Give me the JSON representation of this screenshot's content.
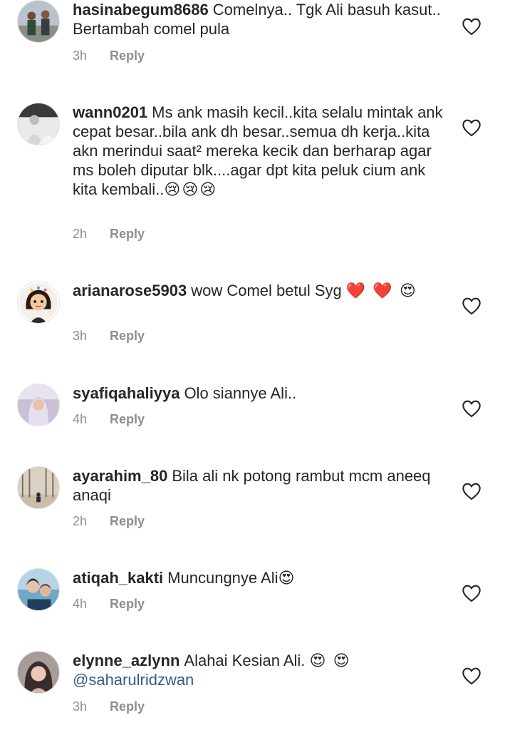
{
  "comments": [
    {
      "username": "hasinabegum8686",
      "text": "Comelnya.. Tgk Ali basuh kasut.. Bertambah comel pula",
      "emoji": "",
      "mention": "",
      "time": "3h",
      "reply": "Reply",
      "avatar": "group-photo-avatar"
    },
    {
      "username": "wann0201",
      "text": "Ms ank masih kecil..kita selalu mintak ank cepat besar..bila ank dh besar..semua dh kerja..kita akn merindui saat² mereka kecik dan berharap agar ms boleh diputar blk....agar dpt kita peluk cium ank kita kembali..",
      "emoji": "😢😢😢",
      "mention": "",
      "time": "2h",
      "reply": "Reply",
      "avatar": "grayscale-photo-avatar"
    },
    {
      "username": "arianarose5903",
      "text": "wow Comel betul Syg",
      "emoji": "❤️ ❤️ 😍",
      "mention": "",
      "time": "3h",
      "reply": "Reply",
      "avatar": "cartoon-girl-avatar"
    },
    {
      "username": "syafiqahaliyya",
      "text": "Olo siannye Ali..",
      "emoji": "",
      "mention": "",
      "time": "4h",
      "reply": "Reply",
      "avatar": "hijab-photo-avatar"
    },
    {
      "username": "ayarahim_80",
      "text": "Bila ali nk potong rambut mcm aneeq anaqi",
      "emoji": "",
      "mention": "",
      "time": "2h",
      "reply": "Reply",
      "avatar": "forest-photo-avatar"
    },
    {
      "username": "atiqah_kakti",
      "text": "Muncungnye Ali",
      "emoji": "😍",
      "mention": "",
      "time": "4h",
      "reply": "Reply",
      "avatar": "selfie-photo-avatar"
    },
    {
      "username": "elynne_azlynn",
      "text": "Alahai Kesian Ali.",
      "emoji": "😍 😍",
      "mention": "@saharulridzwan",
      "time": "3h",
      "reply": "Reply",
      "avatar": "portrait-photo-avatar"
    }
  ],
  "colors": {
    "text": "#262626",
    "meta": "#8e8e8e",
    "mention": "#385a8c",
    "heart_stroke": "#262626"
  },
  "icons": {
    "like": "heart-outline-icon"
  }
}
